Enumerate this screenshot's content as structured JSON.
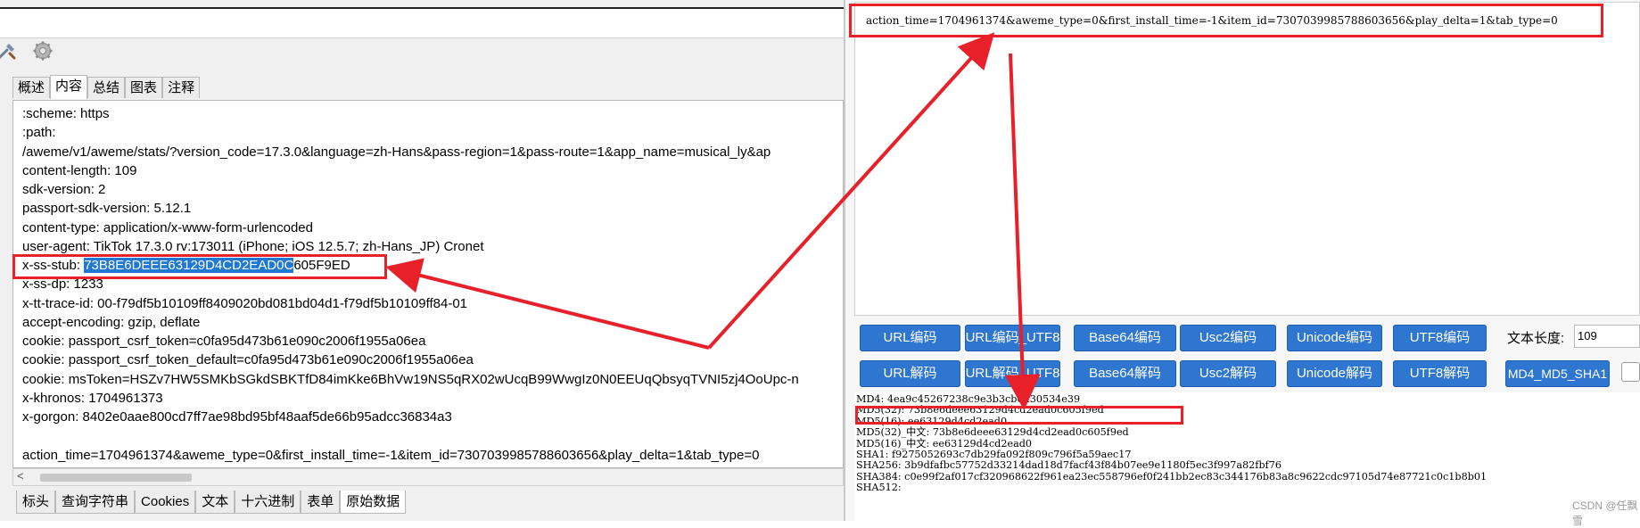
{
  "left_panel": {
    "toolbar_icons": [
      "tools-icon",
      "gear-icon"
    ],
    "tabs_top": [
      {
        "label": "概述",
        "active": false
      },
      {
        "label": "内容",
        "active": true
      },
      {
        "label": "总结",
        "active": false
      },
      {
        "label": "图表",
        "active": false
      },
      {
        "label": "注释",
        "active": false
      }
    ],
    "lines": [
      ":scheme: https",
      ":path:",
      "/aweme/v1/aweme/stats/?version_code=17.3.0&language=zh-Hans&pass-region=1&pass-route=1&app_name=musical_ly&ap",
      "content-length: 109",
      "sdk-version: 2",
      "passport-sdk-version: 5.12.1",
      "content-type: application/x-www-form-urlencoded",
      "user-agent: TikTok 17.3.0 rv:173011 (iPhone; iOS 12.5.7; zh-Hans_JP) Cronet",
      "",
      "x-ss-dp: 1233",
      "x-tt-trace-id: 00-f79df5b10109ff8409020bd081bd04d1-f79df5b10109ff84-01",
      "accept-encoding: gzip, deflate",
      "cookie: passport_csrf_token=c0fa95d473b61e090c2006f1955a06ea",
      "cookie: passport_csrf_token_default=c0fa95d473b61e090c2006f1955a06ea",
      "cookie: msToken=HSZv7HW5SMKbSGkdSBKTfD84imKke6BhVw19NS5qRX02wUcqB99WwgIz0N0EEUqQbsyqTVNI5zj4OoUpc-n",
      "x-khronos: 1704961373",
      "x-gorgon: 8402e0aae800cd7ff7ae98bd95bf48aaf5de66b95adcc36834a3",
      "",
      "action_time=1704961374&aweme_type=0&first_install_time=-1&item_id=7307039985788603656&play_delta=1&tab_type=0"
    ],
    "stub_line": {
      "prefix": "x-ss-stub: ",
      "highlighted": "73B8E6DEEE63129D4CD2EAD0C",
      "rest": "605F9ED"
    },
    "tabs_bottom": [
      {
        "label": "标头",
        "active": false
      },
      {
        "label": "查询字符串",
        "active": false
      },
      {
        "label": "Cookies",
        "active": false
      },
      {
        "label": "文本",
        "active": false
      },
      {
        "label": "十六进制",
        "active": false
      },
      {
        "label": "表单",
        "active": false
      },
      {
        "label": "原始数据",
        "active": true
      }
    ]
  },
  "right_panel": {
    "input_text": "action_time=1704961374&aweme_type=0&first_install_time=-1&item_id=7307039985788603656&play_delta=1&tab_type=0",
    "buttons_row1": [
      "URL编码",
      "URL编码_UTF8",
      "Base64编码",
      "Usc2编码",
      "Unicode编码",
      "UTF8编码"
    ],
    "buttons_row2": [
      "URL解码",
      "URL解码_UTF8",
      "Base64解码",
      "Usc2解码",
      "Unicode解码",
      "UTF8解码",
      "MD4_MD5_SHA1"
    ],
    "length_label": "文本长度:",
    "length_value": "109",
    "output_lines": [
      "MD4: 4ea9c45267238c9e3b3cb0d30534e39",
      "MD5(32): 73b8e6deee63129d4cd2ead0c605f9ed",
      "MD5(16): ee63129d4cd2ead0",
      "MD5(32)_中文: 73b8e6deee63129d4cd2ead0c605f9ed",
      "MD5(16)_中文: ee63129d4cd2ead0",
      "SHA1: f9275052693c7db29fa092f809c796f5a59aec17",
      "SHA256: 3b9dfafbc57752d33214dad18d7facf43f84b07ee9e1180f5ec3f997a82fbf76",
      "SHA384: c0e99f2af017cf320968622f961ea23ec558796ef0f241bb2ec83c344176b83a8c9622cdc97105d74e87721c0c1b8b01",
      "SHA512:"
    ],
    "watermark": "CSDN @任飘雪"
  },
  "colors": {
    "highlight": "#1f78d1",
    "button": "#2e76d0",
    "annotation": "#e8202a"
  }
}
